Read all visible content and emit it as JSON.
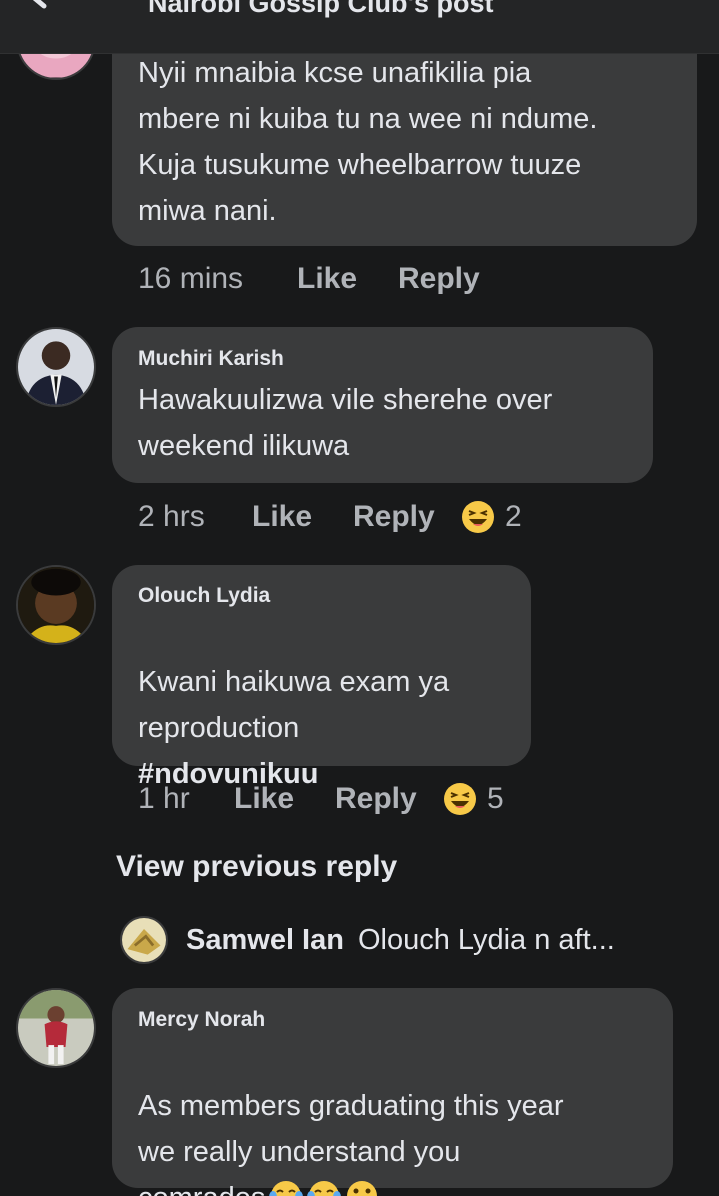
{
  "header": {
    "title": "Nairobi Gossip Club's post"
  },
  "comments": [
    {
      "author": "",
      "text": "Nyii mnaibia kcse unafikilia pia\nmbere ni kuiba tu na wee ni ndume.\nKuja tusukume wheelbarrow tuuze\nmiwa nani.",
      "time": "16 mins",
      "like": "Like",
      "reply": "Reply"
    },
    {
      "author": "Muchiri Karish",
      "text": "Hawakuulizwa vile sherehe over\nweekend ilikuwa",
      "time": "2 hrs",
      "like": "Like",
      "reply": "Reply",
      "reactions": "2"
    },
    {
      "author": "Olouch Lydia",
      "text": " Kwani haikuwa exam ya\nreproduction",
      "hashtag": "#ndovunikuu",
      "time": "1 hr",
      "like": "Like",
      "reply": "Reply",
      "reactions": "5"
    },
    {
      "author": "Mercy Norah",
      "text": " As members graduating this year\nwe really understand you\ncomrades"
    }
  ],
  "view_previous": "View previous reply",
  "nested_reply": {
    "author": "Samwel Ian",
    "text": "Olouch Lydia n aft..."
  },
  "colors": {
    "background": "#18191a",
    "bubble": "#3a3b3c",
    "text": "#e4e6eb",
    "meta": "#b0b3b8"
  },
  "icons": [
    "back-arrow-icon",
    "laughing-emoji-icon",
    "tears-of-joy-emoji-icon",
    "hand-over-mouth-emoji-icon"
  ]
}
